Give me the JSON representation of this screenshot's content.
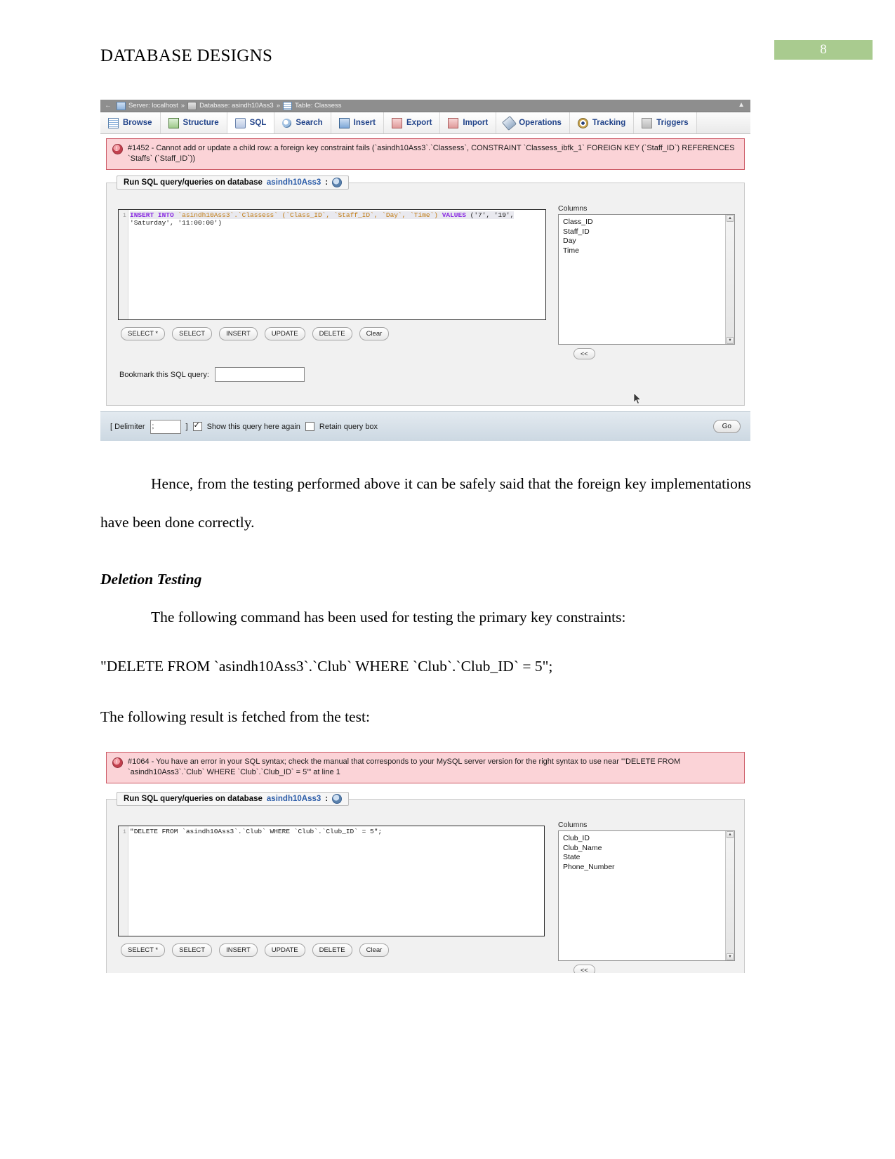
{
  "document": {
    "header_title": "DATABASE DESIGNS",
    "page_number": "8",
    "accent_color": "#a9cb8f"
  },
  "paragraphs": {
    "p1": "Hence, from the testing performed above it can be safely said that the foreign key implementations have been done correctly.",
    "heading_deletion": "Deletion Testing",
    "p2": "The following command has been used for testing the primary key constraints:",
    "p3": "\"DELETE FROM `asindh10Ass3`.`Club` WHERE `Club`.`Club_ID` = 5\";",
    "p4": "The following result is fetched from the test:"
  },
  "screenshot1": {
    "breadcrumb": {
      "back_arrow": "←",
      "server": "Server: localhost",
      "sep1": "»",
      "database": "Database: asindh10Ass3",
      "sep2": "»",
      "table": "Table: Classess",
      "collapse_icon": "▲"
    },
    "tabs": [
      {
        "label": "Browse",
        "icon": "browse-icon"
      },
      {
        "label": "Structure",
        "icon": "structure-icon"
      },
      {
        "label": "SQL",
        "icon": "sql-icon"
      },
      {
        "label": "Search",
        "icon": "search-icon"
      },
      {
        "label": "Insert",
        "icon": "insert-icon"
      },
      {
        "label": "Export",
        "icon": "export-icon"
      },
      {
        "label": "Import",
        "icon": "import-icon"
      },
      {
        "label": "Operations",
        "icon": "operations-icon"
      },
      {
        "label": "Tracking",
        "icon": "tracking-icon"
      },
      {
        "label": "Triggers",
        "icon": "triggers-icon"
      }
    ],
    "error": "#1452 - Cannot add or update a child row: a foreign key constraint fails (`asindh10Ass3`.`Classess`, CONSTRAINT `Classess_ibfk_1` FOREIGN KEY (`Staff_ID`) REFERENCES `Staffs` (`Staff_ID`))",
    "panel_legend": {
      "prefix": "Run SQL query/queries on database",
      "database": "asindh10Ass3",
      "suffix": ":"
    },
    "sql": {
      "line_number": "1",
      "keyword1": "INSERT INTO",
      "target": "`asindh10Ass3`.`Classess`",
      "columns": "(`Class_ID`, `Staff_ID`, `Day`, `Time`)",
      "keyword2": "VALUES",
      "values_line1": "('7', '19',",
      "values_line2": "'Saturday', '11:00:00')"
    },
    "buttons": [
      "SELECT *",
      "SELECT",
      "INSERT",
      "UPDATE",
      "DELETE",
      "Clear"
    ],
    "columns_label": "Columns",
    "columns_list": [
      "Class_ID",
      "Staff_ID",
      "Day",
      "Time"
    ],
    "back_button": "<<",
    "bookmark_label": "Bookmark this SQL query:",
    "bookmark_value": "",
    "footer": {
      "delimiter_open": "[ Delimiter",
      "delimiter_value": ";",
      "delimiter_close": "]",
      "show_query_label": "Show this query here again",
      "show_query_checked": true,
      "retain_label": "Retain query box",
      "retain_checked": false,
      "go_label": "Go"
    }
  },
  "screenshot2": {
    "error": "#1064 - You have an error in your SQL syntax; check the manual that corresponds to your MySQL server version for the right syntax to use near '\"DELETE FROM `asindh10Ass3`.`Club` WHERE `Club`.`Club_ID` = 5\"' at line 1",
    "panel_legend": {
      "prefix": "Run SQL query/queries on database",
      "database": "asindh10Ass3",
      "suffix": ":"
    },
    "sql": {
      "line_number": "1",
      "text": "\"DELETE FROM `asindh10Ass3`.`Club` WHERE `Club`.`Club_ID` = 5\";"
    },
    "buttons": [
      "SELECT *",
      "SELECT",
      "INSERT",
      "UPDATE",
      "DELETE",
      "Clear"
    ],
    "columns_label": "Columns",
    "columns_list": [
      "Club_ID",
      "Club_Name",
      "State",
      "Phone_Number"
    ],
    "back_button": "<<"
  }
}
